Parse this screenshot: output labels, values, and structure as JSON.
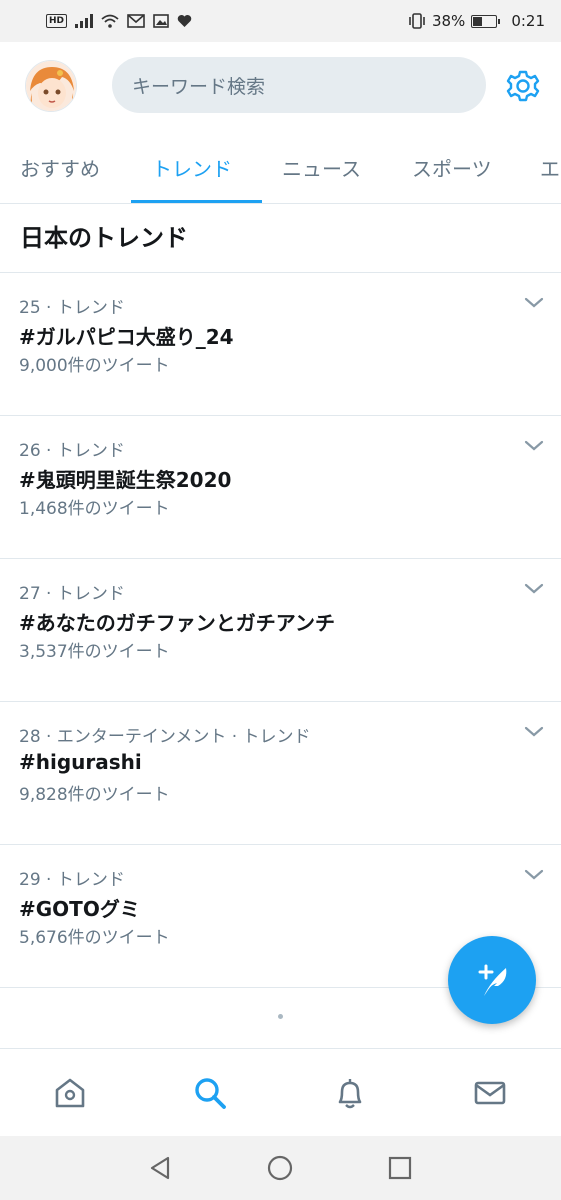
{
  "status_bar": {
    "hd": "HD",
    "battery_percent": "38%",
    "battery_level": 0.38,
    "time": "0:21",
    "icons": [
      "signal-icon",
      "wifi-icon",
      "mail-icon",
      "image-icon",
      "heart-icon",
      "vibrate-icon",
      "battery-icon"
    ]
  },
  "header": {
    "avatar_icon": "profile-avatar",
    "search_placeholder": "キーワード検索",
    "settings_icon": "gear-icon"
  },
  "tabs": [
    {
      "label": "おすすめ",
      "active": false
    },
    {
      "label": "トレンド",
      "active": true
    },
    {
      "label": "ニュース",
      "active": false
    },
    {
      "label": "スポーツ",
      "active": false
    },
    {
      "label": "エ",
      "active": false
    }
  ],
  "section_title": "日本のトレンド",
  "trends": [
    {
      "meta": "25 · トレンド",
      "name": "#ガルパピコ大盛り_24",
      "count": "9,000件のツイート"
    },
    {
      "meta": "26 · トレンド",
      "name": "#鬼頭明里誕生祭2020",
      "count": "1,468件のツイート"
    },
    {
      "meta": "27 · トレンド",
      "name": "#あなたのガチファンとガチアンチ",
      "count": "3,537件のツイート"
    },
    {
      "meta": "28 · エンターテインメント · トレンド",
      "name": "#higurashi",
      "count": "9,828件のツイート"
    },
    {
      "meta": "29 · トレンド",
      "name": "#GOTOグミ",
      "count": "5,676件のツイート"
    }
  ],
  "fab": {
    "icon": "compose-tweet-icon"
  },
  "bottom_nav": [
    {
      "icon": "home-icon",
      "active": false
    },
    {
      "icon": "search-icon",
      "active": true
    },
    {
      "icon": "notifications-icon",
      "active": false
    },
    {
      "icon": "messages-icon",
      "active": false
    }
  ],
  "system_nav": [
    "back-icon",
    "home-circle-icon",
    "recents-icon"
  ],
  "colors": {
    "accent": "#1da1f2",
    "text": "#14171a",
    "secondary": "#657786",
    "divider": "#e1e8ed"
  }
}
